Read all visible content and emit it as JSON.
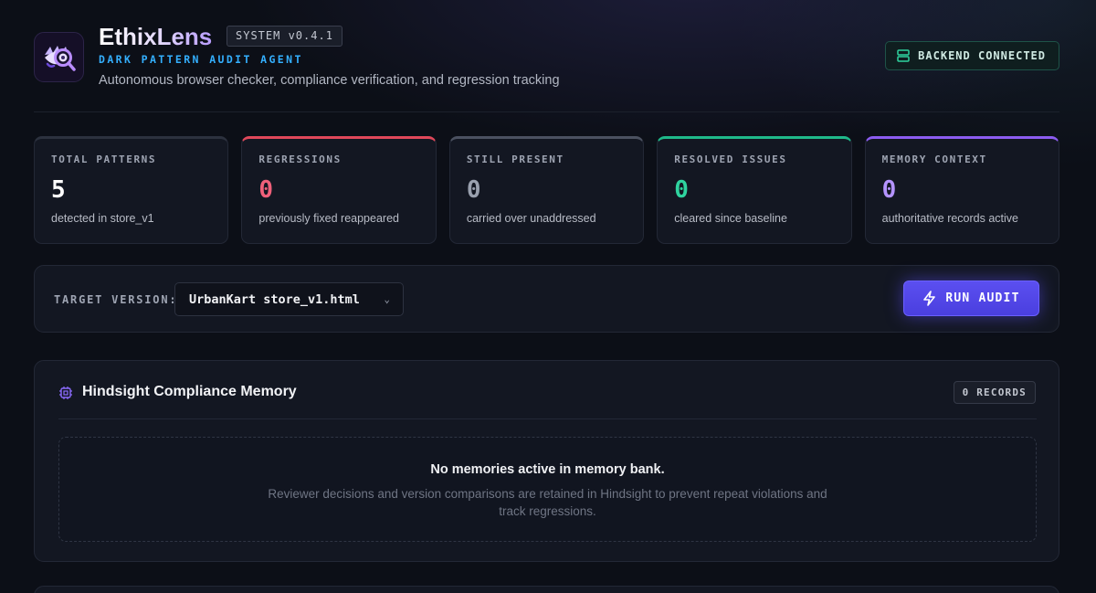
{
  "app": {
    "title": "EthixLens",
    "version": "SYSTEM v0.4.1",
    "subtitle": "DARK PATTERN AUDIT AGENT",
    "tagline": "Autonomous browser checker, compliance verification, and regression tracking",
    "connection_status": "BACKEND CONNECTED",
    "logo_icon": "eye-magnifier-icon",
    "connection_icon": "server-icon"
  },
  "stats": [
    {
      "label": "TOTAL PATTERNS",
      "value": "5",
      "sub": "detected in store_v1",
      "accent": "#2c313e",
      "value_color": "#ffffff"
    },
    {
      "label": "REGRESSIONS",
      "value": "0",
      "sub": "previously fixed reappeared",
      "accent": "#e0485a",
      "value_color": "#f0607a"
    },
    {
      "label": "STILL PRESENT",
      "value": "0",
      "sub": "carried over unaddressed",
      "accent": "#4b5160",
      "value_color": "#9aa1af"
    },
    {
      "label": "RESOLVED ISSUES",
      "value": "0",
      "sub": "cleared since baseline",
      "accent": "#1fb98a",
      "value_color": "#2fd39f"
    },
    {
      "label": "MEMORY CONTEXT",
      "value": "0",
      "sub": "authoritative records active",
      "accent": "#8c5cf0",
      "value_color": "#b493ff"
    }
  ],
  "controls": {
    "target_label": "TARGET VERSION:",
    "selected_version": "UrbanKart store_v1.html",
    "run_label": "RUN AUDIT",
    "run_icon": "lightning-icon"
  },
  "memory": {
    "title": "Hindsight Compliance Memory",
    "icon": "chip-icon",
    "records_badge": "0 RECORDS",
    "empty_title": "No memories active in memory bank.",
    "empty_desc": "Reviewer decisions and version comparisons are retained in Hindsight to prevent repeat violations and track regressions."
  }
}
